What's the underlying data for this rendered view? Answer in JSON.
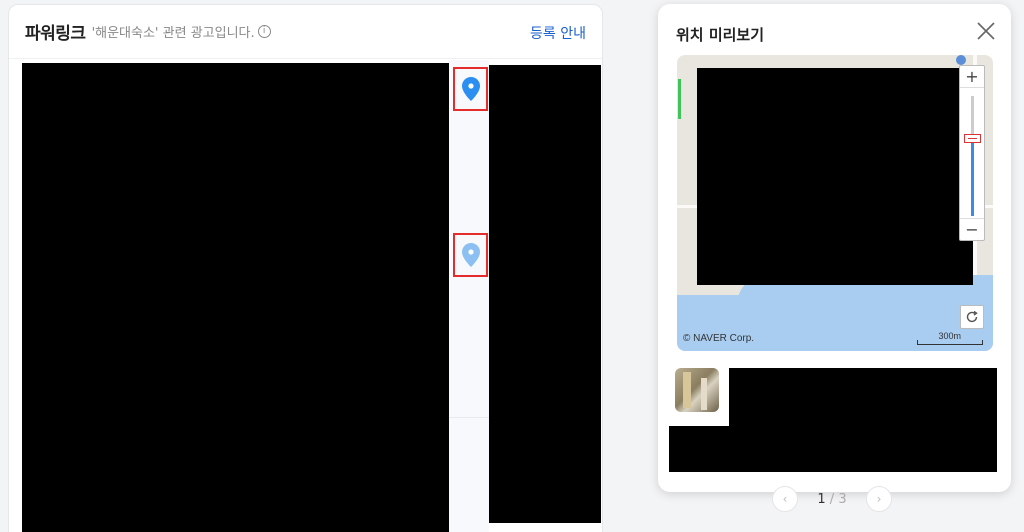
{
  "power_link": {
    "title": "파워링크",
    "subtitle": "'해운대숙소' 관련 광고입니다.",
    "info_icon": "info-circle-icon",
    "register_label": "등록 안내",
    "marker_color_active": "#2b8ef0",
    "marker_color_inactive": "#8cc0f3"
  },
  "preview": {
    "title": "위치 미리보기",
    "close_icon": "close-icon",
    "map": {
      "zoom_in": "+",
      "zoom_out": "−",
      "copyright": "© NAVER Corp.",
      "scale": "300m",
      "refresh_icon": "refresh-icon"
    }
  },
  "pagination": {
    "current": "1",
    "separator": "/",
    "total": "3",
    "prev_icon": "chevron-left-icon",
    "next_icon": "chevron-right-icon"
  }
}
